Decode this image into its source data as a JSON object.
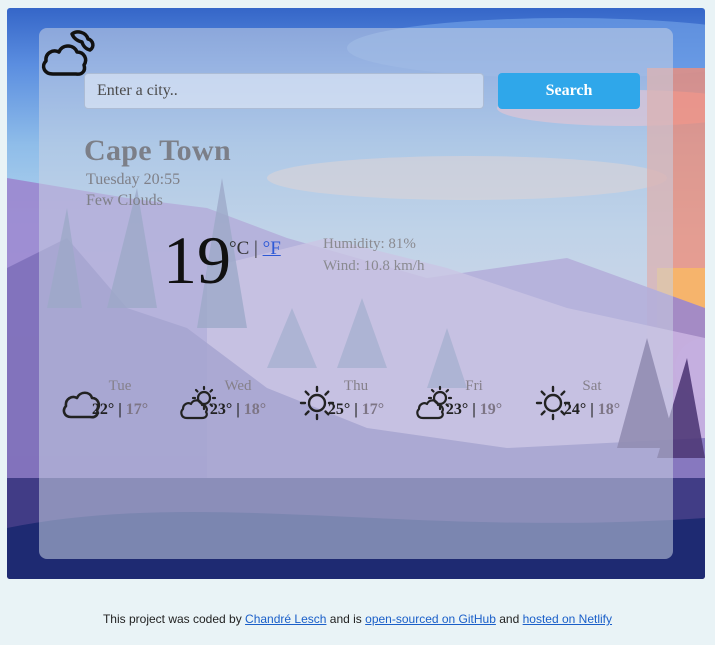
{
  "search": {
    "placeholder": "Enter a city..",
    "button_label": "Search"
  },
  "current": {
    "city": "Cape Town",
    "datetime": "Tuesday 20:55",
    "description": "Few Clouds",
    "icon": "cloud-moon-icon",
    "temperature": "19",
    "unit_celsius": "°C",
    "unit_separator": "|",
    "unit_fahrenheit": "°F",
    "humidity": "Humidity: 81%",
    "wind": "Wind: 10.8 km/h"
  },
  "forecast": [
    {
      "day": "Tue",
      "icon": "cloud-icon",
      "max": "22°",
      "sep": "|",
      "min": "17°"
    },
    {
      "day": "Wed",
      "icon": "sun-cloud-icon",
      "max": "23°",
      "sep": "|",
      "min": "18°"
    },
    {
      "day": "Thu",
      "icon": "sun-icon",
      "max": "25°",
      "sep": "|",
      "min": "17°"
    },
    {
      "day": "Fri",
      "icon": "sun-cloud-icon",
      "max": "23°",
      "sep": "|",
      "min": "19°"
    },
    {
      "day": "Sat",
      "icon": "sun-icon",
      "max": "24°",
      "sep": "|",
      "min": "18°"
    }
  ],
  "footer": {
    "prefix": "This project was coded by",
    "author": "Chandré Lesch",
    "middle": "and is",
    "github": "open-sourced on GitHub",
    "and": "and",
    "netlify": "hosted on Netlify"
  },
  "colors": {
    "accent": "#2fa7ea",
    "link": "#1a5fc9"
  }
}
